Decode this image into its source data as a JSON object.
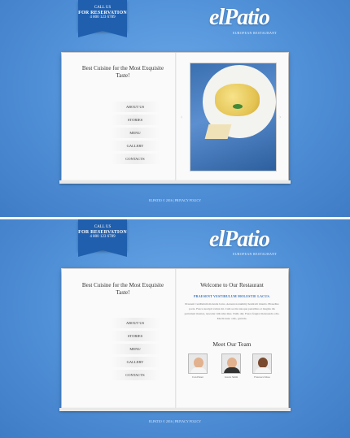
{
  "top": {
    "ribbon": {
      "line1": "CALL US",
      "line2": "FOR RESERVATION",
      "phone": "4 800 123 6789"
    },
    "logo": "elPatio",
    "tagline": "EUROPEAN RESTAURANT",
    "heading": "Best Cuisine for the Most Exquisite Taste!",
    "menu": [
      "ABOUT US",
      "STORIES",
      "MENU",
      "GALLERY",
      "CONTACTS"
    ],
    "footer": "ELPATIO  © 2016  |  PRIVACY POLICY",
    "arrow_left": "‹",
    "arrow_right": "›"
  },
  "bottom": {
    "ribbon": {
      "line1": "CALL US",
      "line2": "FOR RESERVATION",
      "phone": "4 800 123 6789"
    },
    "logo": "elPatio",
    "tagline": "EUROPEAN RESTAURANT",
    "heading": "Best Cuisine for the Most Exquisite Taste!",
    "menu": [
      "ABOUT US",
      "STORIES",
      "MENU",
      "GALLERY",
      "CONTACTS"
    ],
    "welcome_title": "Welcome to Our Restaurant",
    "welcome_sub": "PRAESENT VESTIBULUM MOLESTIE LACUS.",
    "welcome_text": "Praesent vestibulum molestie lacus. Aenean nonummy hendrerit mauris. Phasellus porta. Fusce suscipit varius mi. Cum sociis natoque penatibus et magnis dis parturient montes, nascetur ridiculus mus. Nulla dui. Fusce feugiat malesuada odio. Morbi nunc odio, gravida.",
    "team_title": "Meet Our Team",
    "team": [
      {
        "name": "Ivan Planet"
      },
      {
        "name": "Jessica Smith"
      },
      {
        "name": "Francesca Mose"
      }
    ],
    "footer": "ELPATIO  © 2016  |  PRIVACY POLICY"
  }
}
